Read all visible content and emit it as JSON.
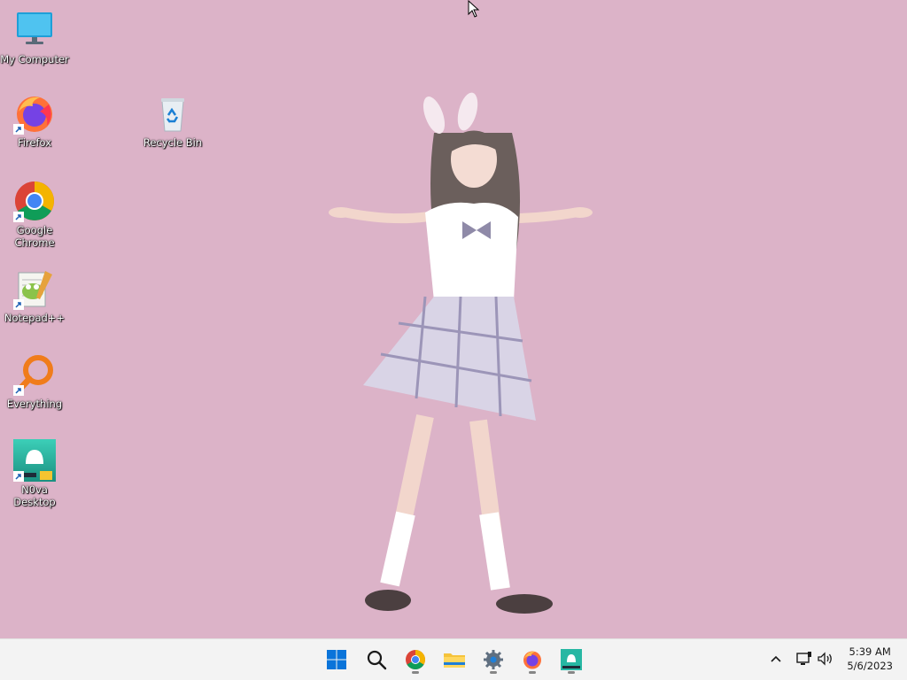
{
  "desktop": {
    "icons": [
      {
        "label": "My Computer",
        "icon": "monitor-icon",
        "shortcut": false
      },
      {
        "label": "Firefox",
        "icon": "firefox-icon",
        "shortcut": true
      },
      {
        "label": "Recycle Bin",
        "icon": "recycle-bin-icon",
        "shortcut": false
      },
      {
        "label": "Google Chrome",
        "icon": "chrome-icon",
        "shortcut": true
      },
      {
        "label": "Notepad++",
        "icon": "notepadpp-icon",
        "shortcut": true
      },
      {
        "label": "Everything",
        "icon": "everything-search-icon",
        "shortcut": true
      },
      {
        "label": "N0va Desktop",
        "icon": "n0va-desktop-icon",
        "shortcut": true
      }
    ],
    "wallpaper_color": "#dcb3c8"
  },
  "taskbar": {
    "pinned": [
      {
        "icon": "windows-start-icon",
        "running": false
      },
      {
        "icon": "search-icon",
        "running": false
      },
      {
        "icon": "chrome-icon",
        "running": true
      },
      {
        "icon": "file-explorer-icon",
        "running": false
      },
      {
        "icon": "settings-gear-icon",
        "running": true
      },
      {
        "icon": "firefox-icon",
        "running": true
      },
      {
        "icon": "n0va-desktop-icon",
        "running": true
      }
    ],
    "tray": {
      "icons": [
        "chevron-up-icon",
        "network-icon",
        "volume-icon"
      ],
      "time": "5:39 AM",
      "date": "5/6/2023"
    }
  }
}
